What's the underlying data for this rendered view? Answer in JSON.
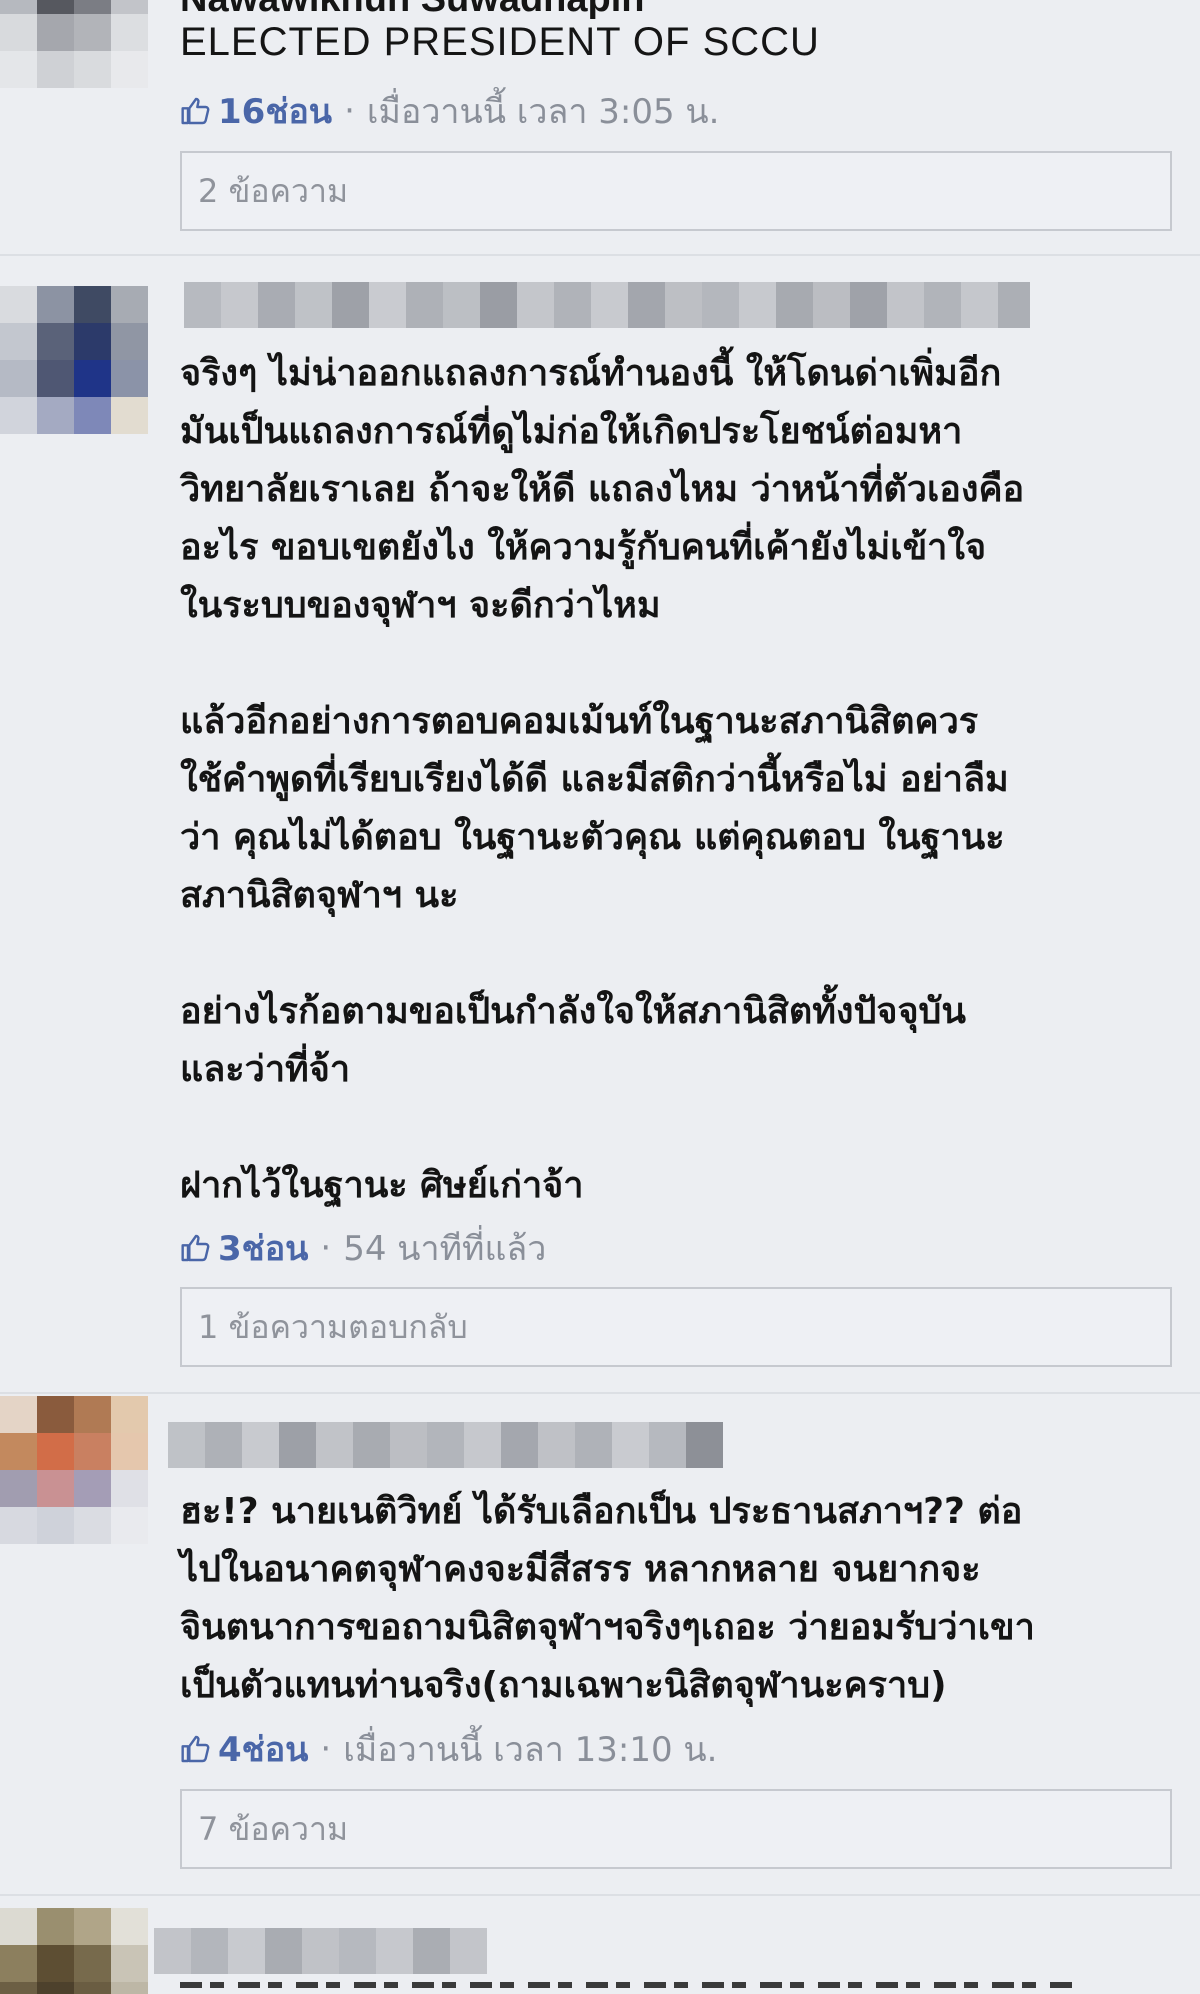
{
  "comments": [
    {
      "author_partial": "Nawawikhun Suwadhapin",
      "headline": "ELECTED PRESIDENT OF SCCU",
      "likes_label": "16ช่อน",
      "dot": "·",
      "timestamp": "เมื่อวานนี้ เวลา 3:05 น.",
      "reply_label": "2 ข้อความ"
    },
    {
      "text": "จริงๆ ไม่น่าออกแถลงการณ์ทำนองนี้ ให้โดนด่าเพิ่มอีก\nมันเป็นแถลงการณ์ที่ดูไม่ก่อให้เกิดประโยชน์ต่อมหา\nวิทยาลัยเราเลย ถ้าจะให้ดี แถลงไหม ว่าหน้าที่ตัวเองคือ\nอะไร ขอบเขตยังไง ให้ความรู้กับคนที่เค้ายังไม่เข้าใจ\nในระบบของจุฬาฯ จะดีกว่าไหม\n\nแล้วอีกอย่างการตอบคอมเม้นท์ในฐานะสภานิสิตควร\nใช้คำพูดที่เรียบเรียงได้ดี และมีสติกว่านี้หรือไม่ อย่าลืม\nว่า คุณไม่ได้ตอบ ในฐานะตัวคุณ แต่คุณตอบ ในฐานะ\nสภานิสิตจุฬาฯ นะ\n\nอย่างไรก้อตามขอเป็นกำลังใจให้สภานิสิตทั้งปัจจุบัน\nและว่าที่จ้า\n\nฝากไว้ในฐานะ ศิษย์เก่าจ้า",
      "likes_label": "3ช่อน",
      "dot": "·",
      "timestamp": "54 นาทีที่แล้ว",
      "reply_label": "1 ข้อความตอบกลับ"
    },
    {
      "text": "ฮะ!? นายเนติวิทย์ ได้รับเลือกเป็น ประธานสภาฯ?? ต่อ\nไปในอนาคตจุฬาคงจะมีสีสรร หลากหลาย จนยากจะ\nจินตนาการขอถามนิสิตจุฬาฯจริงๆเถอะ ว่ายอมรับว่าเขา\nเป็นตัวแทนท่านจริง(ถามเฉพาะนิสิตจุฬานะคราบ)",
      "likes_label": "4ช่อน",
      "dot": "·",
      "timestamp": "เมื่อวานนี้ เวลา 13:10 น.",
      "reply_label": "7 ข้อความ"
    }
  ],
  "icons": {
    "like": "thumbs-up-icon"
  },
  "colors": {
    "background": "#eceef2",
    "like_accent": "#4a66a8",
    "meta_text": "#8a8f99",
    "reply_border": "#c6c9cf"
  }
}
